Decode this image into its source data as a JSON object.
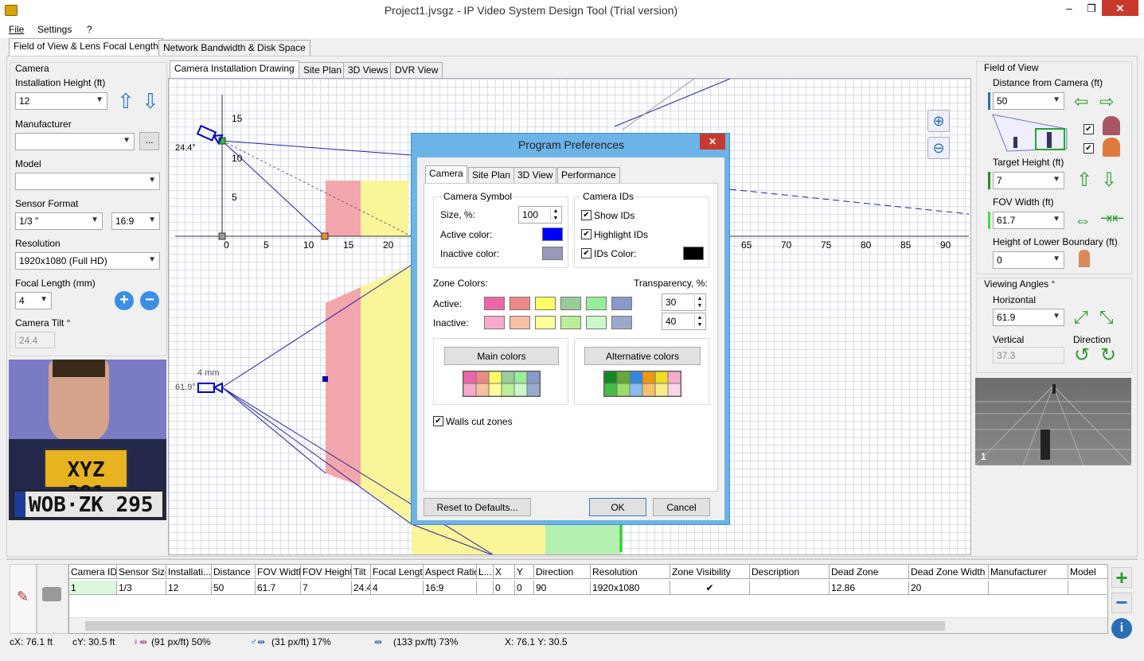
{
  "window": {
    "title": "Project1.jvsgz - IP Video System Design Tool (Trial version)",
    "minimize": "–",
    "restore": "❐",
    "close": "✕"
  },
  "menu": {
    "file": "File",
    "settings": "Settings",
    "help": "?"
  },
  "main_tabs": [
    "Field of View & Lens Focal Length",
    "Network Bandwidth & Disk Space"
  ],
  "left": {
    "camera_group": "Camera",
    "installation_height_label": "Installation Height (ft)",
    "installation_height": "12",
    "manufacturer_label": "Manufacturer",
    "manufacturer": "",
    "browse": "...",
    "model_label": "Model",
    "model": "",
    "sensor_format_label": "Sensor Format",
    "sensor_format": "1/3 \"",
    "aspect": "16:9",
    "resolution_label": "Resolution",
    "resolution": "1920x1080 (Full HD)",
    "focal_length_label": "Focal Length (mm)",
    "focal_length": "4",
    "camera_tilt_label": "Camera Tilt °",
    "camera_tilt": "24.4",
    "plate1": "XYZ 391",
    "plate2": "WOB·ZK 295"
  },
  "view_tabs": [
    "Camera Installation Drawing",
    "Site Plan",
    "3D Views",
    "DVR View"
  ],
  "drawing": {
    "tilt_angle": "24.4°",
    "h_angle": "61.9°",
    "lens": "4 mm",
    "y_ticks": [
      "15",
      "10",
      "5"
    ],
    "x_ticks": [
      "0",
      "5",
      "10",
      "15",
      "20"
    ],
    "x_ticks_right": [
      "65",
      "70",
      "75",
      "80",
      "85",
      "90"
    ]
  },
  "right": {
    "fov_group": "Field of View",
    "distance_label": "Distance from Camera  (ft)",
    "distance": "50",
    "target_height_label": "Target Height (ft)",
    "target_height": "7",
    "fov_width_label": "FOV Width (ft)",
    "fov_width": "61.7",
    "lower_boundary_label": "Height of Lower Boundary (ft)",
    "lower_boundary": "0",
    "angles_group": "Viewing Angles °",
    "horizontal_label": "Horizontal",
    "horizontal": "61.9",
    "vertical_label": "Vertical",
    "vertical": "37.3",
    "direction_label": "Direction",
    "preview_number": "1"
  },
  "dialog": {
    "title": "Program Preferences",
    "close": "✕",
    "tabs": [
      "Camera",
      "Site Plan",
      "3D View",
      "Performance"
    ],
    "symbol_group": "Camera Symbol",
    "size_label": "Size, %:",
    "size": "100",
    "active_color_label": "Active color:",
    "inactive_color_label": "Inactive color:",
    "ids_group": "Camera IDs",
    "show_ids": "Show IDs",
    "highlight_ids": "Highlight IDs",
    "ids_color": "IDs Color:",
    "zone_colors": "Zone Colors:",
    "transparency": "Transparency, %:",
    "active": "Active:",
    "inactive": "Inactive:",
    "active_transparency": "30",
    "inactive_transparency": "40",
    "main_colors": "Main colors",
    "alt_colors": "Alternative colors",
    "walls_cut": "Walls cut zones",
    "reset": "Reset to Defaults...",
    "ok": "OK",
    "cancel": "Cancel",
    "colors": {
      "active_symbol": "#0000ff",
      "inactive_symbol": "#9999bb",
      "ids": "#000000",
      "zones_active": [
        "#ee66aa",
        "#ee8888",
        "#ffff66",
        "#99cc99",
        "#99ee99",
        "#8899cc"
      ],
      "zones_inactive": [
        "#f7aacc",
        "#f7c0a0",
        "#ffff99",
        "#bbee99",
        "#ccf7cc",
        "#99aacc"
      ]
    }
  },
  "table": {
    "headers": [
      "Camera ID",
      "Sensor Size",
      "Installati...",
      "Distance",
      "FOV Width",
      "FOV Height",
      "Tilt",
      "Focal Length",
      "Aspect Ratio",
      "L...",
      "X",
      "Y",
      "Direction",
      "Resolution",
      "Zone Visibility",
      "Description",
      "Dead Zone",
      "Dead Zone Width",
      "Manufacturer",
      "Model"
    ],
    "row": [
      "1",
      "1/3",
      "12",
      "50",
      "61.7",
      "7",
      "24.4",
      "4",
      "16:9",
      "",
      "0",
      "0",
      "90",
      "1920x1080",
      "✔",
      "",
      "12.86",
      "20",
      "",
      ""
    ]
  },
  "status": {
    "cx": "cX: 76.1 ft",
    "cy": "cY: 30.5 ft",
    "s1": "(91 px/ft) 50%",
    "s2": "(31 px/ft) 17%",
    "s3": "(133 px/ft) 73%",
    "xy": "X: 76.1 Y: 30.5"
  }
}
